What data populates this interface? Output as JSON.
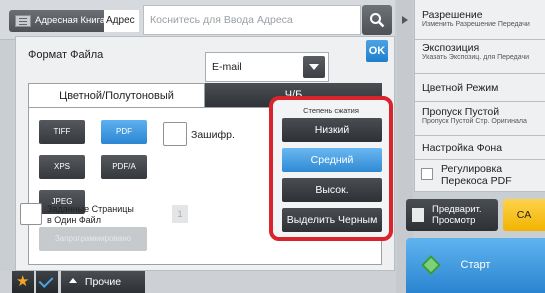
{
  "topbar": {
    "address_book": "Адресная Книга",
    "address_label": "Адрес",
    "address_placeholder": "Коснитесь для Ввода Адреса"
  },
  "panel": {
    "file_format_label": "Формат Файла",
    "file_format_value": "E-mail",
    "ok": "OK",
    "tabs": [
      "Цветной/Полутоновый",
      "Ч/Б"
    ],
    "active_tab": "Цветной/Полутоновый",
    "file_types": [
      "TIFF",
      "PDF",
      "XPS",
      "PDF/A",
      "JPEG"
    ],
    "selected_file_type": "PDF",
    "programmed_label": "Запрограммировано",
    "encrypt_label": "Зашифр.",
    "compression": {
      "title": "Степень сжатия",
      "options": [
        "Низкий",
        "Средний",
        "Высок.",
        "Выделить Черным"
      ],
      "selected": "Средний"
    },
    "pages_label_line1": "Заданные Страницы",
    "pages_label_line2": "в Один Файл",
    "pages_value": "1"
  },
  "bottombar": {
    "other_label": "Прочие"
  },
  "right_menu": {
    "items": [
      {
        "title": "Разрешение",
        "sub": "Изменить Разрешение Передачи"
      },
      {
        "title": "Экспозиция",
        "sub": "Указать Экспозиц. для Передачи"
      },
      {
        "title": "Цветной Режим",
        "sub": ""
      },
      {
        "title": "Пропуск Пустой",
        "sub": "Пропуск Пустой Стр. Оригинала"
      },
      {
        "title": "Настройка Фона",
        "sub": ""
      },
      {
        "title_line1": "Регулировка",
        "title_line2": "Перекоса PDF"
      }
    ],
    "preview_line1": "Предварит.",
    "preview_line2": "Просмотр",
    "ca": "CA",
    "start": "Старт"
  },
  "colors": {
    "accent_blue": "#2b86d2",
    "highlight_red": "#d9232d",
    "ca_yellow": "#f0b400"
  }
}
